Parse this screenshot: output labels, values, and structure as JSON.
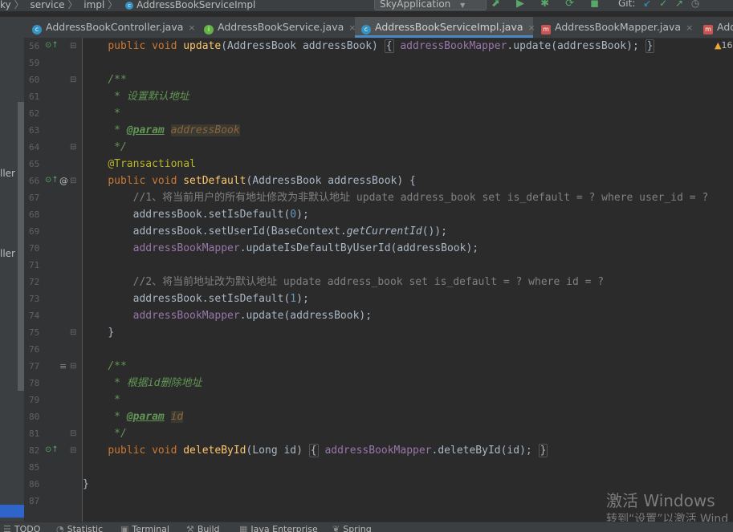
{
  "breadcrumb": {
    "items": [
      "ky",
      "service",
      "impl",
      "AddressBookServiceImpl"
    ],
    "sep": "〉"
  },
  "run_config": {
    "label": "SkyApplication",
    "arrow": "▼"
  },
  "toolbar": {
    "icons": "⬈ ▶ ✱ ⟳ ◼"
  },
  "git": {
    "label": "Git:",
    "icons": [
      "↙",
      "✓",
      "↗",
      "◷"
    ]
  },
  "tabs": [
    {
      "label": "AddressBookController.java",
      "icon": "c",
      "close": "×"
    },
    {
      "label": "AddressBookService.java",
      "icon": "i",
      "close": "×"
    },
    {
      "label": "AddressBookServiceImpl.java",
      "icon": "c",
      "close": "×",
      "active": true
    },
    {
      "label": "AddressBookMapper.java",
      "icon": "m",
      "close": "×"
    },
    {
      "label": "Addr",
      "icon": "m"
    }
  ],
  "left_strip": {
    "labels": [
      "ller",
      "ller"
    ]
  },
  "warning": {
    "icon": "▲",
    "count": "16"
  },
  "gutter_icons": {
    "override": "⊙↑",
    "at": "@",
    "fold": "⊟",
    "list": "≡"
  },
  "lines": {
    "l56": {
      "num": "56",
      "kw": "public void ",
      "fn": "update",
      "a": "(AddressBook addressBook) ",
      "b": "{",
      "c": " addressBookMapper",
      "d": ".update(addressBook); ",
      "e": "}"
    },
    "l59": {
      "num": "59"
    },
    "l60": {
      "num": "60",
      "doc": "/**"
    },
    "l61": {
      "num": "61",
      "doc": " * 设置默认地址"
    },
    "l62": {
      "num": "62",
      "doc": " *"
    },
    "l63": {
      "num": "63",
      "doc": " * ",
      "tag": "@param",
      "val": "addressBook"
    },
    "l64": {
      "num": "64",
      "doc": " */"
    },
    "l65": {
      "num": "65",
      "ann": "@Transactional"
    },
    "l66": {
      "num": "66",
      "kw": "public void ",
      "fn": "setDefault",
      "a": "(AddressBook addressBook) {"
    },
    "l67": {
      "num": "67",
      "cm": "    //1、将当前用户的所有地址修改为非默认地址 update address_book set is_default = ? where user_id = ?"
    },
    "l68": {
      "num": "68",
      "a": "    addressBook.setIsDefault(",
      "n": "0",
      "b": ");"
    },
    "l69": {
      "num": "69",
      "a": "    addressBook.setUserId(BaseContext.",
      "i": "getCurrentId",
      "b": "());"
    },
    "l70": {
      "num": "70",
      "f": "    addressBookMapper",
      "a": ".updateIsDefaultByUserId(addressBook);"
    },
    "l71": {
      "num": "71"
    },
    "l72": {
      "num": "72",
      "cm": "    //2、将当前地址改为默认地址 update address_book set is_default = ? where id = ?"
    },
    "l73": {
      "num": "73",
      "a": "    addressBook.setIsDefault(",
      "n": "1",
      "b": ");"
    },
    "l74": {
      "num": "74",
      "f": "    addressBookMapper",
      "a": ".update(addressBook);"
    },
    "l75": {
      "num": "75",
      "a": "}"
    },
    "l76": {
      "num": "76"
    },
    "l77": {
      "num": "77",
      "doc": "/**"
    },
    "l78": {
      "num": "78",
      "doc": " * 根据id删除地址"
    },
    "l79": {
      "num": "79",
      "doc": " *"
    },
    "l80": {
      "num": "80",
      "doc": " * ",
      "tag": "@param",
      "val": "id"
    },
    "l81": {
      "num": "81",
      "doc": " */"
    },
    "l82": {
      "num": "82",
      "kw": "public void ",
      "fn": "deleteById",
      "a": "(Long id) ",
      "b": "{",
      "c": " addressBookMapper",
      "d": ".deleteById(id); ",
      "e": "}"
    },
    "l85": {
      "num": "85"
    },
    "l86": {
      "num": "86",
      "a": "}"
    },
    "l87": {
      "num": "87"
    }
  },
  "statusbar": [
    {
      "icon": "☰",
      "label": "TODO"
    },
    {
      "icon": "◔",
      "label": "Statistic"
    },
    {
      "icon": "▣",
      "label": "Terminal"
    },
    {
      "icon": "⚒",
      "label": "Build"
    },
    {
      "icon": "▦",
      "label": "Java Enterprise"
    },
    {
      "icon": "❦",
      "label": "Spring"
    }
  ],
  "watermark": {
    "line1": "激活 Windows",
    "line2": "转到“设置”以激活 Wind"
  }
}
